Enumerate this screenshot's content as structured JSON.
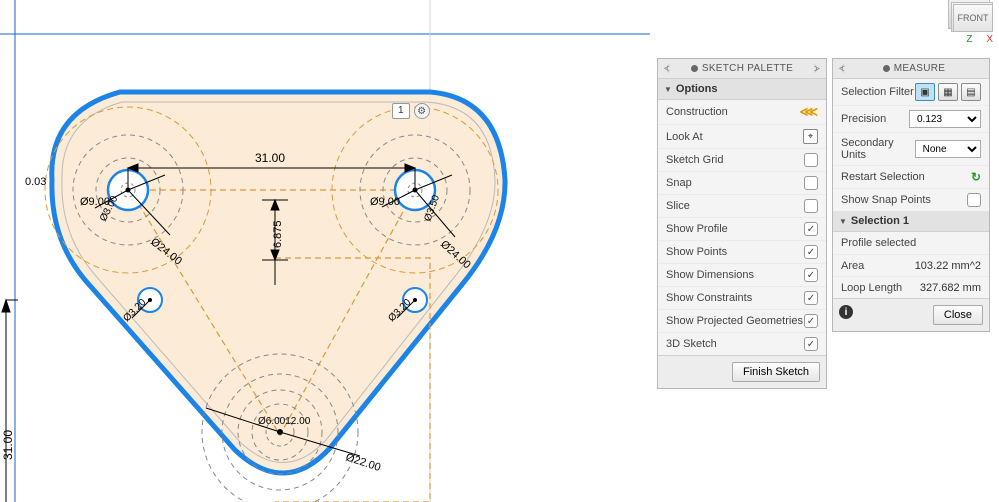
{
  "viewcube": {
    "face": "FRONT",
    "axis_z": "Z",
    "axis_x": "X"
  },
  "sketch_panel": {
    "title": "SKETCH PALETTE",
    "options_header": "Options",
    "rows": {
      "construction": {
        "label": "Construction"
      },
      "look_at": {
        "label": "Look At"
      },
      "sketch_grid": {
        "label": "Sketch Grid"
      },
      "snap": {
        "label": "Snap"
      },
      "slice": {
        "label": "Slice"
      },
      "show_profile": {
        "label": "Show Profile"
      },
      "show_points": {
        "label": "Show Points"
      },
      "show_dimensions": {
        "label": "Show Dimensions"
      },
      "show_constraints": {
        "label": "Show Constraints"
      },
      "show_projected": {
        "label": "Show Projected Geometries"
      },
      "three_d_sketch": {
        "label": "3D Sketch"
      }
    },
    "finish_button": "Finish Sketch"
  },
  "measure_panel": {
    "title": "MEASURE",
    "rows": {
      "selection_filter": {
        "label": "Selection Filter"
      },
      "precision": {
        "label": "Precision",
        "value": "0.123"
      },
      "secondary_units": {
        "label": "Secondary Units",
        "value": "None"
      },
      "restart": {
        "label": "Restart Selection"
      },
      "show_snap_points": {
        "label": "Show Snap Points"
      }
    },
    "selection_header": "Selection 1",
    "selection_note": "Profile selected",
    "area": {
      "label": "Area",
      "value": "103.22 mm^2"
    },
    "loop_length": {
      "label": "Loop Length",
      "value": "327.682 mm"
    },
    "close_button": "Close"
  },
  "sketch": {
    "badge": "1",
    "dimensions": {
      "horizontal_31": "31.00",
      "vertical_6_875": "6.875",
      "left_vertical_31": "31.00",
      "offset_03": "0.03",
      "left_hole_d9": "Ø9.00",
      "left_ring_d24": "Ø24.00",
      "left_inner_d3": "Ø3.00",
      "right_hole_d9": "Ø9.00",
      "right_ring_d24": "Ø24.00",
      "right_inner_d3": "Ø3.50",
      "small_left_d3_20": "Ø3.20",
      "small_right_d3_20": "Ø3.20",
      "bottom_d12": "Ø6.0012.00",
      "bottom_d22": "Ø22.00"
    }
  }
}
